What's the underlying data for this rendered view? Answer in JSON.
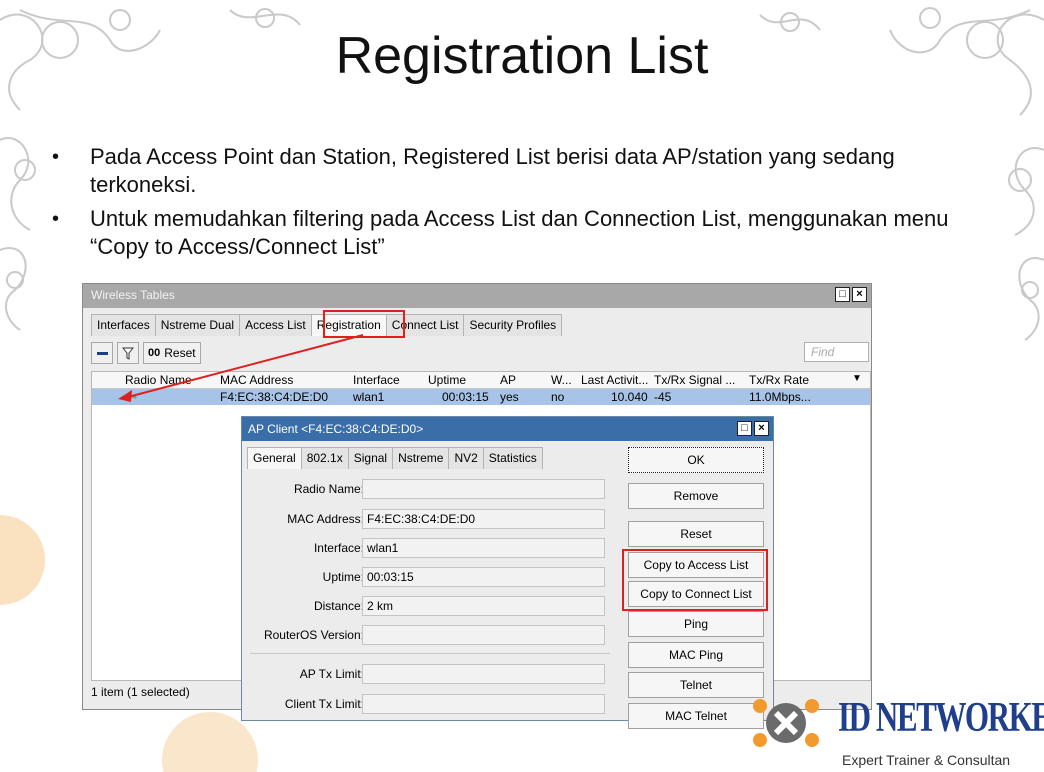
{
  "slide": {
    "title": "Registration List",
    "bullets": [
      "Pada Access Point dan Station, Registered List berisi data AP/station yang sedang terkoneksi.",
      "Untuk memudahkan filtering pada Access List dan Connection List, menggunakan menu “Copy to Access/Connect List”"
    ]
  },
  "window": {
    "title": "Wireless Tables",
    "tabs": [
      "Interfaces",
      "Nstreme Dual",
      "Access List",
      "Registration",
      "Connect List",
      "Security Profiles"
    ],
    "toolbar": {
      "reset_label": "Reset",
      "reset_prefix": "00",
      "find_placeholder": "Find"
    },
    "columns": [
      "Radio Name",
      "MAC Address",
      "Interface",
      "Uptime",
      "AP",
      "W...",
      "Last Activit...",
      "Tx/Rx Signal ...",
      "Tx/Rx Rate"
    ],
    "row": {
      "mac": "F4:EC:38:C4:DE:D0",
      "interface": "wlan1",
      "uptime": "00:03:15",
      "ap": "yes",
      "w": "no",
      "last_activity": "10.040",
      "signal": "-45",
      "rate": "11.0Mbps..."
    },
    "status": "1 item (1 selected)"
  },
  "dialog": {
    "title": "AP Client <F4:EC:38:C4:DE:D0>",
    "tabs": [
      "General",
      "802.1x",
      "Signal",
      "Nstreme",
      "NV2",
      "Statistics"
    ],
    "fields": [
      {
        "label": "Radio Name:",
        "value": ""
      },
      {
        "label": "MAC Address:",
        "value": "F4:EC:38:C4:DE:D0"
      },
      {
        "label": "Interface:",
        "value": "wlan1"
      },
      {
        "label": "Uptime:",
        "value": "00:03:15"
      },
      {
        "label": "Distance:",
        "value": "2 km"
      },
      {
        "label": "RouterOS Version:",
        "value": ""
      },
      {
        "label": "AP Tx Limit:",
        "value": ""
      },
      {
        "label": "Client Tx Limit:",
        "value": ""
      }
    ],
    "buttons": [
      "OK",
      "Remove",
      "Reset",
      "Copy to Access List",
      "Copy to Connect List",
      "Ping",
      "MAC Ping",
      "Telnet",
      "MAC Telnet"
    ]
  },
  "logo": {
    "name": "ID NETWORKERS",
    "tagline": "Expert Trainer & Consultan"
  },
  "colors": {
    "highlight": "#e02020",
    "selection": "#a7c4e8",
    "dialog_title": "#3a6ea9"
  }
}
